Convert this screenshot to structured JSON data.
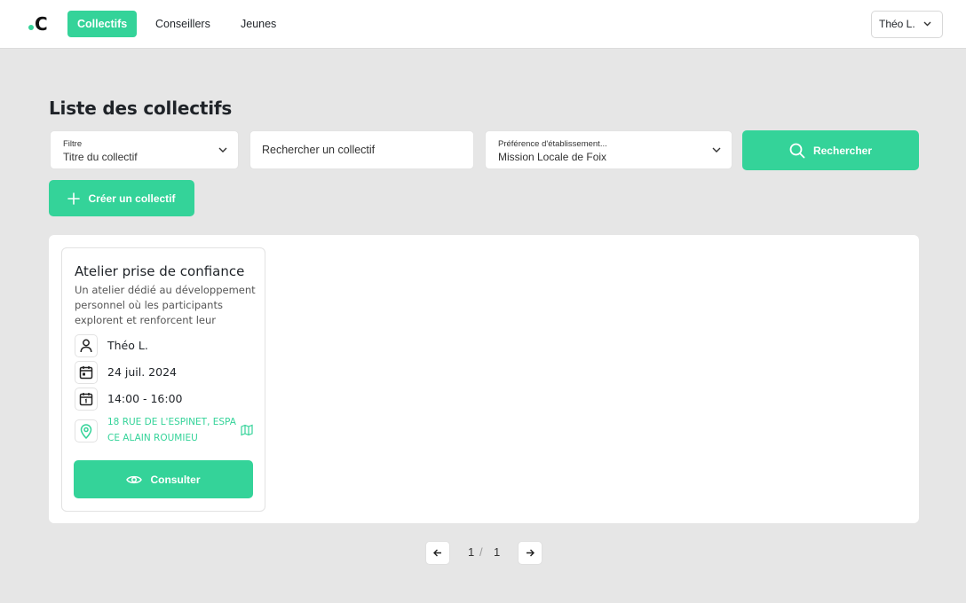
{
  "app": {
    "logo_letter": "C"
  },
  "nav": {
    "items": [
      {
        "label": "Collectifs",
        "active": true
      },
      {
        "label": "Conseillers",
        "active": false
      },
      {
        "label": "Jeunes",
        "active": false
      }
    ]
  },
  "user": {
    "name": "Théo L."
  },
  "page": {
    "title": "Liste des collectifs"
  },
  "filters": {
    "filter_label": "Filtre",
    "filter_value": "Titre du collectif",
    "search_placeholder": "Rechercher un collectif",
    "establishment_label": "Préférence d'établissement...",
    "establishment_value": "Mission Locale de Foix",
    "search_button": "Rechercher"
  },
  "actions": {
    "create_button": "Créer un collectif"
  },
  "collectifs": [
    {
      "title": "Atelier prise de confiance",
      "description": "Un atelier dédié au développement personnel où les participants explorent et renforcent leur confianc…",
      "advisor": "Théo L.",
      "date": "24 juil. 2024",
      "time": "14:00 - 16:00",
      "address": "18 RUE DE L'ESPINET, ESPACE ALAIN ROUMIEU",
      "consult_button": "Consulter"
    }
  ],
  "pagination": {
    "current": "1",
    "separator": "/",
    "total": "1"
  },
  "colors": {
    "accent": "#34d399",
    "background": "#e6e6e6"
  }
}
